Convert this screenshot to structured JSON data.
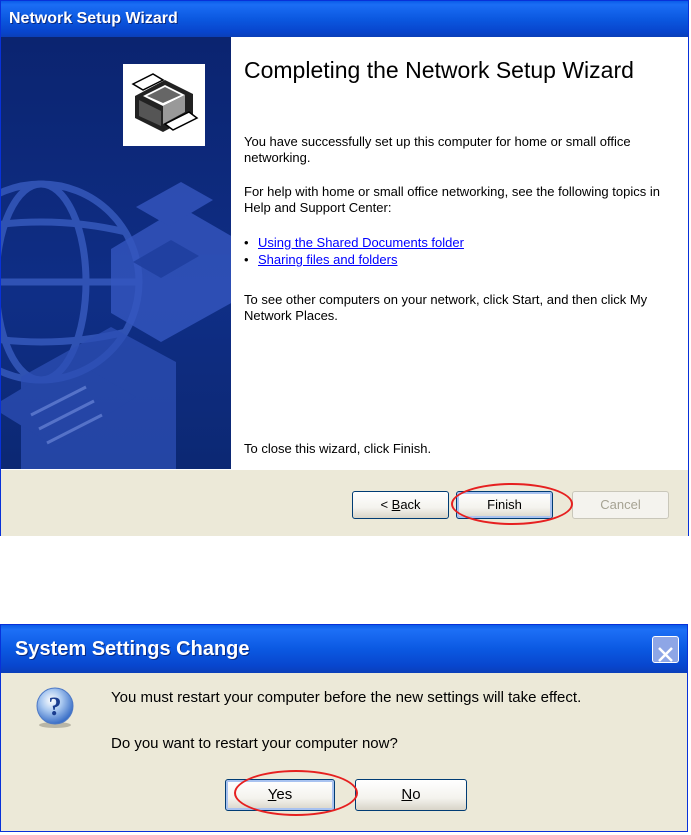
{
  "wizard": {
    "title": "Network Setup Wizard",
    "heading": "Completing the Network Setup Wizard",
    "success_text": "You have successfully set up this computer for home or small office networking.",
    "help_text": "For help with home or small office networking, see the following topics in Help and Support Center:",
    "links": [
      {
        "label": "Using the Shared Documents folder"
      },
      {
        "label": "Sharing files and folders"
      }
    ],
    "network_text": "To see other computers on your network, click Start, and then click My Network Places.",
    "close_text": "To close this wizard, click Finish.",
    "buttons": {
      "back_prefix": "< ",
      "back_accel": "B",
      "back_rest": "ack",
      "finish": "Finish",
      "cancel": "Cancel"
    },
    "side_icon": "network-printer-icon"
  },
  "dialog": {
    "title": "System Settings Change",
    "message": "You must restart your computer before the new settings will take effect.",
    "question": "Do you want to restart your computer now?",
    "buttons": {
      "yes_accel": "Y",
      "yes_rest": "es",
      "no_accel": "N",
      "no_rest": "o"
    },
    "icon": "question-icon"
  },
  "colors": {
    "titlebar": "#0845cd",
    "sidepanel": "#0f2e86",
    "link": "#0000ff",
    "highlight_ring": "#e62020",
    "dialog_bg": "#ece9d8"
  }
}
